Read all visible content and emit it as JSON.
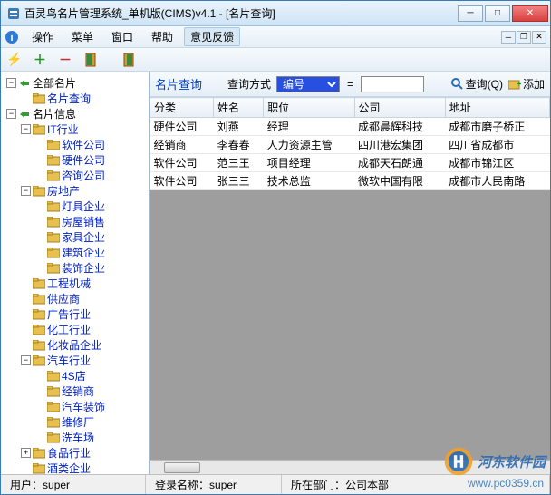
{
  "window": {
    "title": "百灵鸟名片管理系统_单机版(CIMS)v4.1 - [名片查询]"
  },
  "menu": {
    "operate": "操作",
    "menu": "菜单",
    "window": "窗口",
    "help": "帮助",
    "feedback": "意见反馈"
  },
  "tree": {
    "root": "全部名片",
    "query": "名片查询",
    "info": "名片信息",
    "items": [
      {
        "label": "IT行业",
        "children": [
          "软件公司",
          "硬件公司",
          "咨询公司"
        ]
      },
      {
        "label": "房地产",
        "children": [
          "灯具企业",
          "房屋销售",
          "家具企业",
          "建筑企业",
          "装饰企业"
        ]
      },
      {
        "label": "工程机械",
        "leaf": true
      },
      {
        "label": "供应商",
        "leaf": true
      },
      {
        "label": "广告行业",
        "leaf": true
      },
      {
        "label": "化工行业",
        "leaf": true
      },
      {
        "label": "化妆品企业",
        "leaf": true
      },
      {
        "label": "汽车行业",
        "children": [
          "4S店",
          "经销商",
          "汽车装饰",
          "维修厂",
          "洗车场"
        ]
      },
      {
        "label": "食品行业",
        "children_closed": true
      },
      {
        "label": "酒类企业",
        "leaf": true
      }
    ]
  },
  "query": {
    "title": "名片查询",
    "mode_label": "查询方式",
    "mode_value": "编号",
    "equals": "=",
    "search_btn": "查询(Q)",
    "add_btn": "添加"
  },
  "grid": {
    "columns": [
      "分类",
      "姓名",
      "职位",
      "公司",
      "地址"
    ],
    "rows": [
      [
        "硬件公司",
        "刘燕",
        "经理",
        "成都晨辉科技",
        "成都市磨子桥正"
      ],
      [
        "经销商",
        "李春春",
        "人力资源主管",
        "四川港宏集团",
        "四川省成都市"
      ],
      [
        "软件公司",
        "范三王",
        "项目经理",
        "成都天石朗通",
        "成都市锦江区"
      ],
      [
        "软件公司",
        "张三三",
        "技术总监",
        "微软中国有限",
        "成都市人民南路"
      ]
    ]
  },
  "status": {
    "user_label": "用户：",
    "user_value": "super",
    "login_label": "登录名称：",
    "login_value": "super",
    "dept_label": "所在部门：",
    "dept_value": "公司本部"
  },
  "watermark": {
    "text": "河东软件园",
    "url": "www.pc0359.cn"
  }
}
